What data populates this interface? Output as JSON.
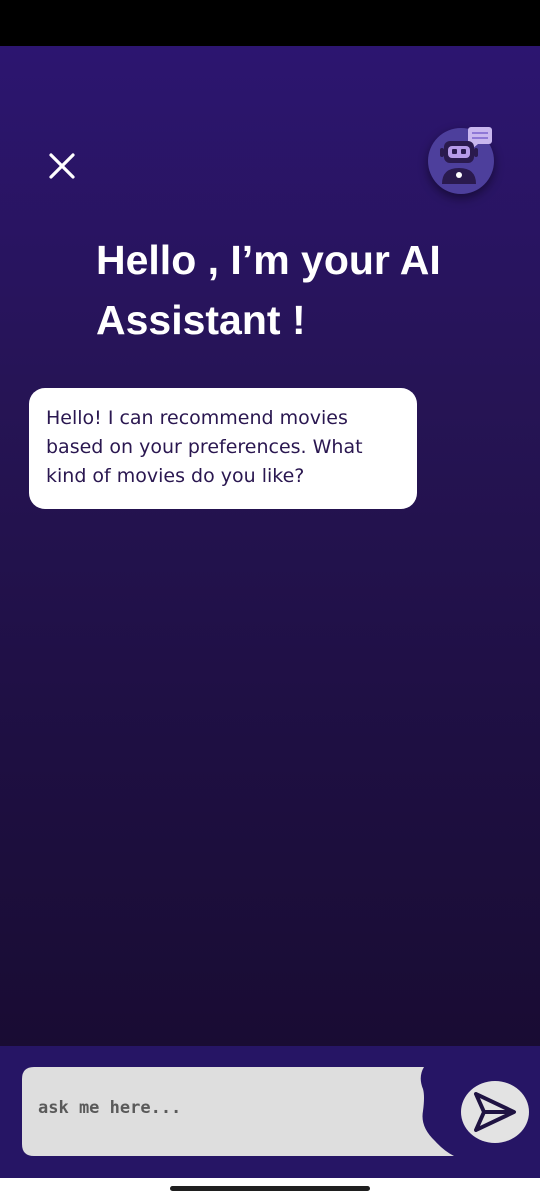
{
  "header": {
    "title": "Hello , I’m your AI Assistant !",
    "close_icon": "close-icon",
    "avatar_icon": "robot-chat-icon"
  },
  "messages": [
    {
      "sender": "assistant",
      "text": "Hello! I can recommend movies based on your preferences. What kind of movies do you like?"
    }
  ],
  "composer": {
    "placeholder": "ask me here...",
    "value": "",
    "send_icon": "send-arrow-icon"
  },
  "colors": {
    "background_top": "#2c1570",
    "background_bottom": "#190c33",
    "input_panel": "#261565",
    "input_field": "#dedede",
    "avatar": "#4d3f9c",
    "bubble": "#ffffff",
    "bubble_text": "#2a1750"
  }
}
